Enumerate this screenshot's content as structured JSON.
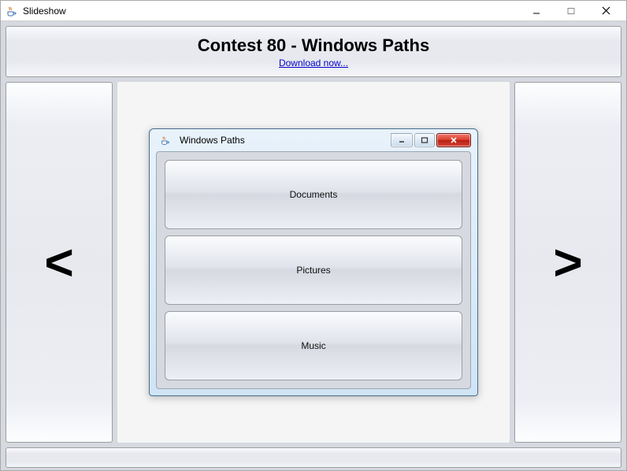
{
  "window": {
    "title": "Slideshow"
  },
  "header": {
    "title": "Contest 80 - Windows Paths",
    "link_label": "Download now..."
  },
  "nav": {
    "prev_glyph": "<",
    "next_glyph": ">"
  },
  "slide": {
    "inner_window_title": "Windows Paths",
    "buttons": [
      "Documents",
      "Pictures",
      "Music"
    ]
  }
}
